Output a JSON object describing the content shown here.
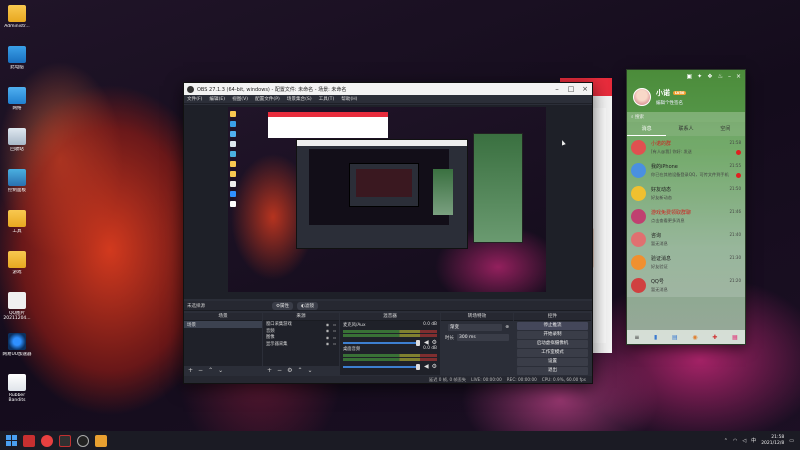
{
  "desktop": {
    "icons": [
      {
        "label": "Administr...",
        "kind": "folder"
      },
      {
        "label": "此电脑",
        "kind": "pc"
      },
      {
        "label": "网络",
        "kind": "net"
      },
      {
        "label": "回收站",
        "kind": "bin"
      },
      {
        "label": "控制面板",
        "kind": "ctrl"
      },
      {
        "label": "工具",
        "kind": "folder"
      },
      {
        "label": "游戏",
        "kind": "folder"
      },
      {
        "label": "QQ图片20211204...",
        "kind": "qq"
      },
      {
        "label": "网易UU加速器",
        "kind": "speed"
      },
      {
        "label": "Rubber Bandits",
        "kind": "doc"
      }
    ]
  },
  "obs": {
    "title": "OBS 27.1.3 (64-bit, windows) - 配置文件: 未命名 - 场景: 未命名",
    "menu": [
      "文件(F)",
      "编辑(E)",
      "视图(V)",
      "配置文件(P)",
      "场景集合(S)",
      "工具(T)",
      "帮助(H)"
    ],
    "no_source_label": "未选择源",
    "scene_btn_1": "属性",
    "scene_btn_2": "滤镜",
    "panels": {
      "scenes": {
        "title": "场景",
        "items": [
          "场景"
        ]
      },
      "sources": {
        "title": "来源",
        "items": [
          "窗口采集游戏",
          "音频",
          "图像",
          "显示器采集"
        ]
      },
      "mixer": {
        "title": "混音器",
        "channels": [
          {
            "name": "麦克风/Aux",
            "db": "0.0 dB"
          },
          {
            "name": "桌面音频",
            "db": "0.0 dB"
          }
        ]
      },
      "transitions": {
        "title": "转场特效",
        "type": "渐变",
        "duration_label": "时长",
        "duration": "300 ms"
      },
      "controls": {
        "title": "控件",
        "buttons": [
          "停止推流",
          "开始录制",
          "启动虚拟摄像机",
          "工作室模式",
          "设置",
          "退出"
        ]
      }
    },
    "status": {
      "live": "LIVE: 00:00:00",
      "rec": "REC: 00:00:00",
      "cpu": "CPU: 0.9%, 60.00 fps",
      "dropped": "延迟 0 帧, 0 帧丢失"
    }
  },
  "qq": {
    "name": "小诺",
    "signature": "编辑个性签名",
    "vip": "LV50",
    "search_placeholder": "搜索",
    "tabs": [
      "消息",
      "联系人",
      "空间"
    ],
    "conversations": [
      {
        "title": "小诺的群",
        "msg": "[有人@我] 你好: 发送",
        "time": "21:58",
        "color": "#e05050",
        "title_red": true
      },
      {
        "title": "我的iPhone",
        "msg": "你已在其他设备登录QQ，可传文件到手机",
        "time": "21:55",
        "color": "#4a90e0",
        "title_red": false
      },
      {
        "title": "好友动态",
        "msg": "好友新动态",
        "time": "21:50",
        "color": "#f0c030",
        "title_red": false
      },
      {
        "title": "游戏免费领取群聊",
        "msg": "点击查看更多消息",
        "time": "21:46",
        "color": "#c04070",
        "title_red": true
      },
      {
        "title": "咨询",
        "msg": "暂无消息",
        "time": "21:40",
        "color": "#e07070",
        "title_red": false
      },
      {
        "title": "验证消息",
        "msg": "好友验证",
        "time": "21:30",
        "color": "#f09030",
        "title_red": false
      },
      {
        "title": "QQ号",
        "msg": "暂无消息",
        "time": "21:20",
        "color": "#d04040",
        "title_red": false
      }
    ]
  },
  "taskbar": {
    "time": "21:58",
    "date": "2021/12/8"
  }
}
